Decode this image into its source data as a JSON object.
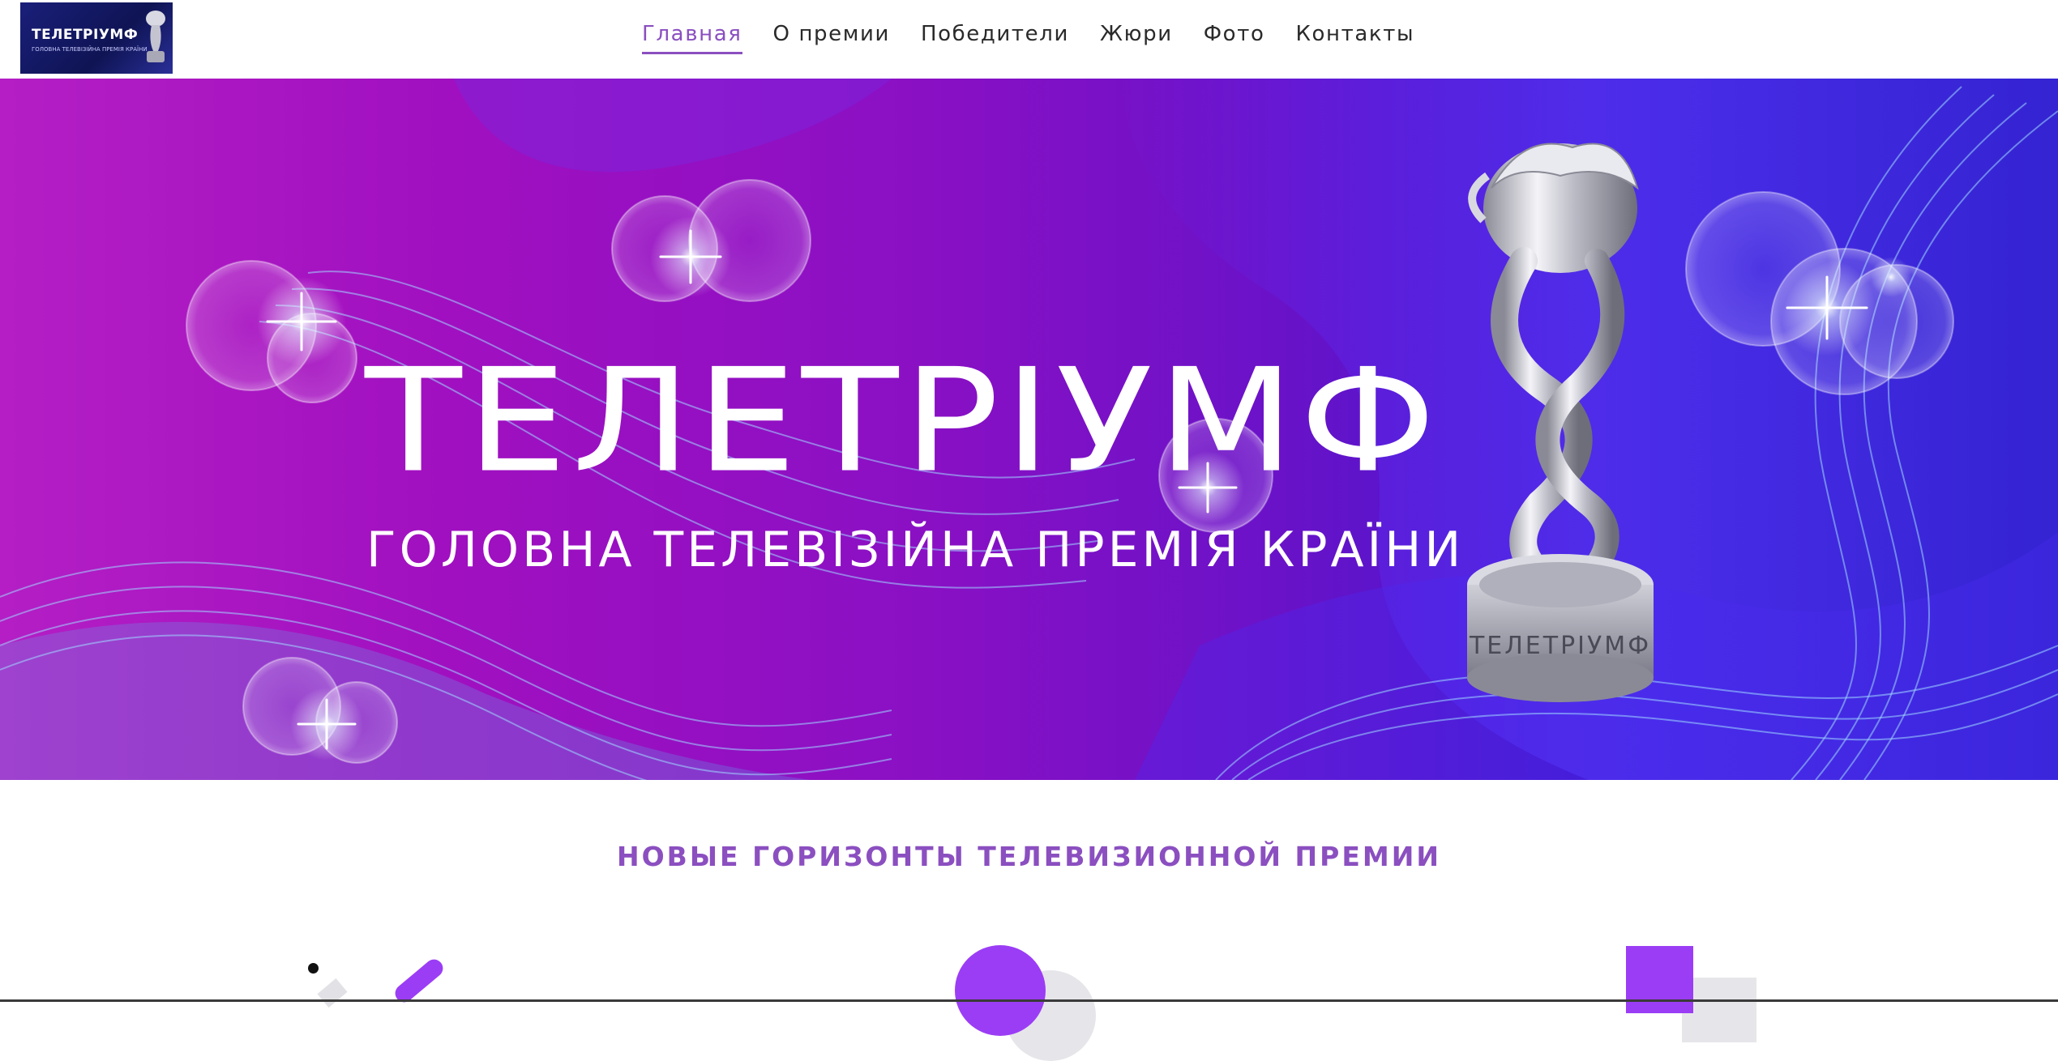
{
  "header": {
    "logo": {
      "text": "ТЕЛЕТРІУМФ",
      "subtitle": "ГОЛОВНА ТЕЛЕВІЗІЙНА ПРЕМІЯ КРАЇНИ"
    },
    "nav": [
      {
        "label": "Главная",
        "active": true
      },
      {
        "label": "О премии",
        "active": false
      },
      {
        "label": "Победители",
        "active": false
      },
      {
        "label": "Жюри",
        "active": false
      },
      {
        "label": "Фото",
        "active": false
      },
      {
        "label": "Контакты",
        "active": false
      }
    ]
  },
  "hero": {
    "title": "ТЕЛЕТРІУМФ",
    "subtitle": "ГОЛОВНА ТЕЛЕВІЗІЙНА ПРЕМІЯ КРАЇНИ",
    "trophy_text": "ТЕЛЕТРІУМФ"
  },
  "section": {
    "heading": "НОВЫЕ ГОРИЗОНТЫ ТЕЛЕВИЗИОННОЙ ПРЕМИИ"
  },
  "colors": {
    "accent": "#8b4fc0",
    "shape": "#9b3df5",
    "hero_left": "#b41ec4",
    "hero_right": "#2010a8"
  }
}
